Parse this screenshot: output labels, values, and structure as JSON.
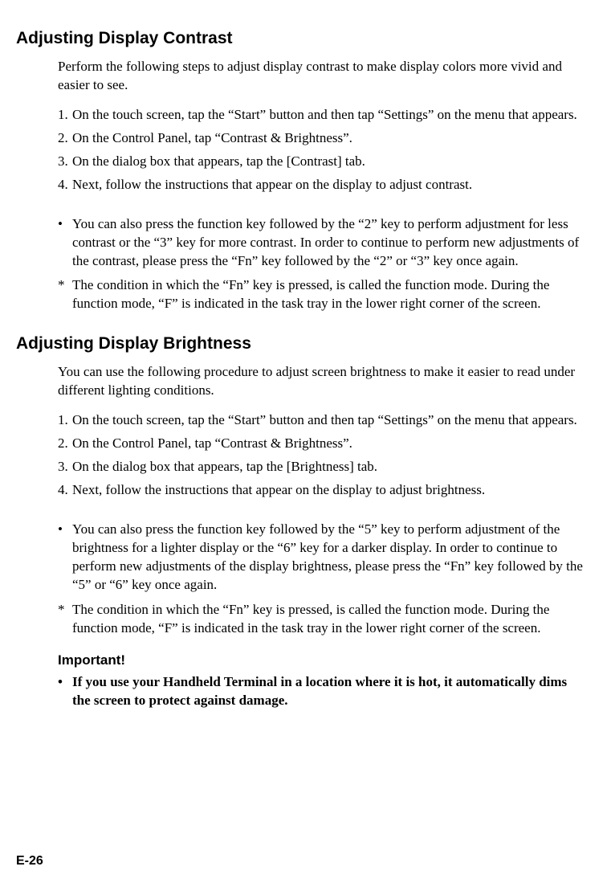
{
  "section1": {
    "heading": "Adjusting Display Contrast",
    "intro": "Perform the following steps to adjust display contrast to make display colors more vivid and easier to see.",
    "steps": [
      "On the touch screen, tap the “Start” button and then tap “Settings” on the menu that appears.",
      "On the Control Panel, tap “Contrast & Brightness”.",
      "On the dialog box that appears, tap the [Contrast] tab.",
      "Next, follow the instructions that appear on the display to adjust contrast."
    ],
    "bullet": "You can also press the function key followed by the “2” key to perform adjustment for less contrast or the “3” key for more contrast. In order to continue to perform new adjustments of the contrast, please press the “Fn” key followed by the “2” or “3” key once again.",
    "note": "The condition in which the “Fn” key is pressed, is called the function mode. During the function mode, “F” is indicated in the task tray in the lower right corner of the screen."
  },
  "section2": {
    "heading": "Adjusting Display Brightness",
    "intro": "You can use the following procedure to adjust screen brightness to make it easier to read under different lighting conditions.",
    "steps": [
      "On the touch screen, tap the “Start” button and then tap “Settings” on the menu that appears.",
      "On the Control Panel, tap “Contrast & Brightness”.",
      "On the dialog box that appears, tap the [Brightness] tab.",
      "Next, follow the instructions that appear on the display to adjust brightness."
    ],
    "bullet": "You can also press the function key followed by the “5” key to perform adjustment of the brightness for a lighter display or the “6” key for a darker display. In order to continue to perform new adjustments of the display brightness, please press the “Fn” key followed by the “5” or “6” key once again.",
    "note": "The condition in which the “Fn” key is pressed, is called the function mode. During the function mode, “F” is indicated in the task tray in the lower right corner of the screen.",
    "important_label": "Important!",
    "important_text": "If you use your Handheld Terminal in a location where it is hot, it automatically dims the screen to protect against damage."
  },
  "page_number": "E-26",
  "markers": {
    "bullet": "•",
    "star": "*",
    "n1": "1.",
    "n2": "2.",
    "n3": "3.",
    "n4": "4."
  }
}
